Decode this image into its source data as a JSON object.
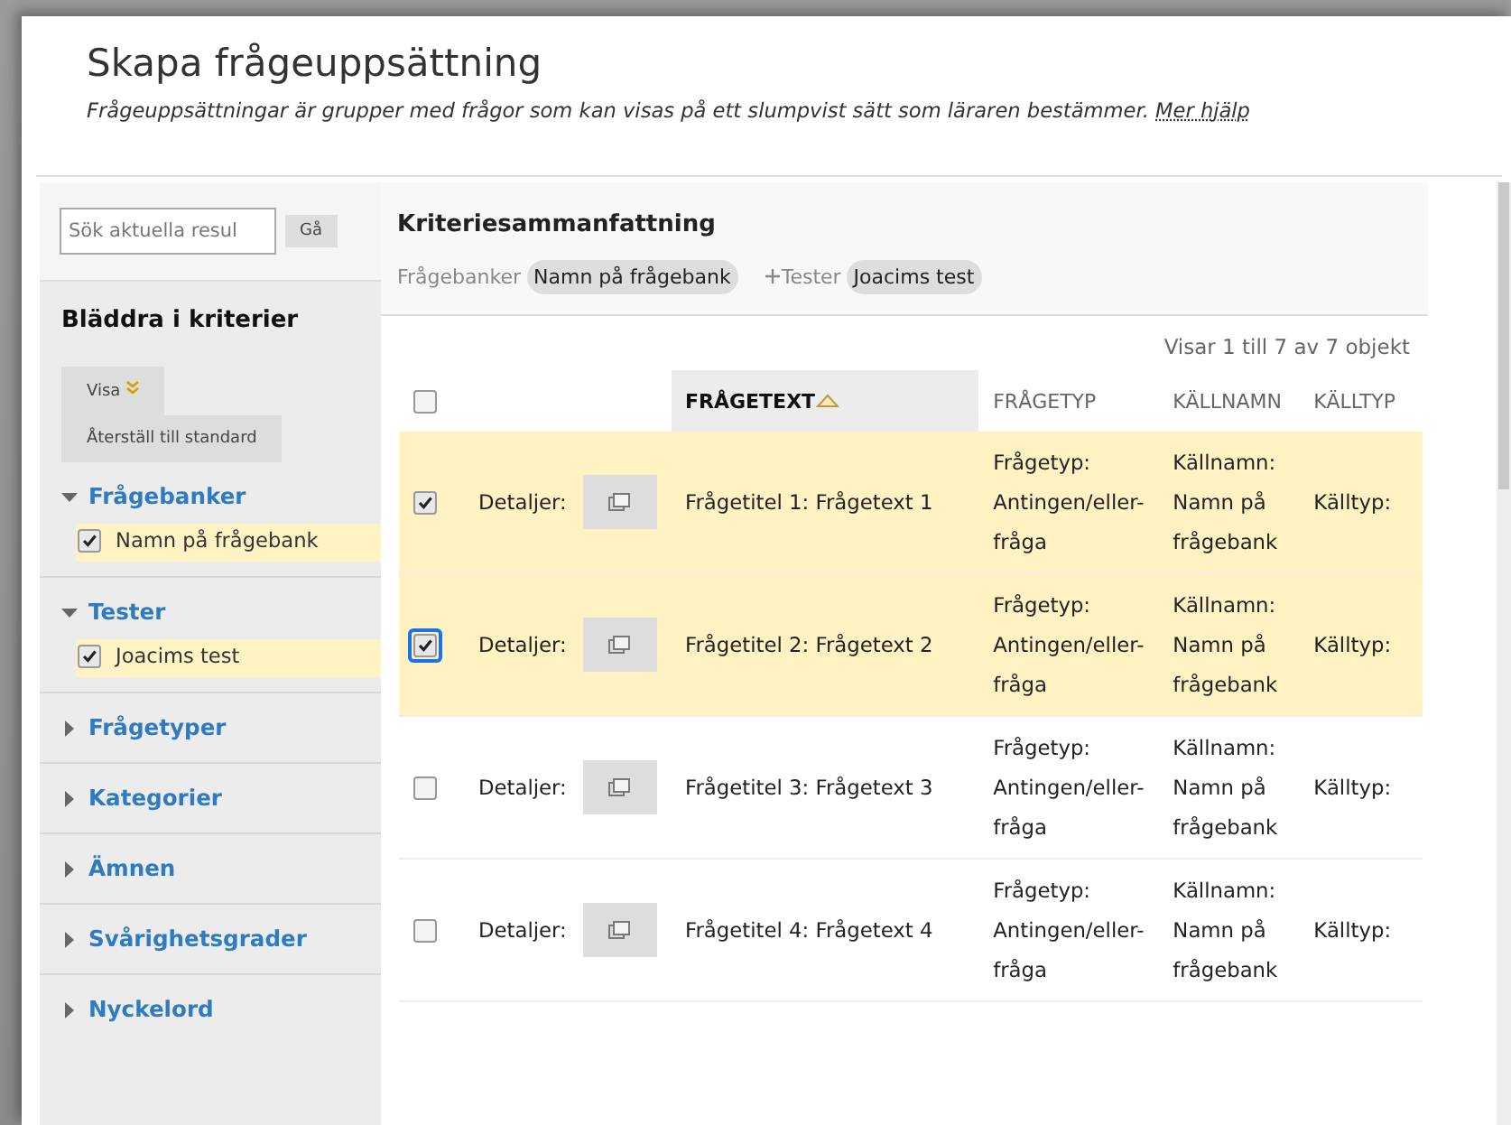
{
  "title": "Skapa frågeuppsättning",
  "description": {
    "text": "Frågeuppsättningar är grupper med frågor som kan visas på ett slumpvist sätt som läraren bestämmer.",
    "link": "Mer hjälp"
  },
  "search": {
    "placeholder": "Sök aktuella resul",
    "button": "Gå"
  },
  "sidebar": {
    "heading": "Bläddra i kriterier",
    "visa_button": "Visa",
    "reset_button": "Återställ till standard",
    "groups": [
      {
        "label": "Frågebanker",
        "expanded": true,
        "items": [
          {
            "label": "Namn på frågebank",
            "checked": true
          }
        ]
      },
      {
        "label": "Tester",
        "expanded": true,
        "items": [
          {
            "label": "Joacims test",
            "checked": true
          }
        ]
      },
      {
        "label": "Frågetyper",
        "expanded": false
      },
      {
        "label": "Kategorier",
        "expanded": false
      },
      {
        "label": "Ämnen",
        "expanded": false
      },
      {
        "label": "Svårighetsgrader",
        "expanded": false
      },
      {
        "label": "Nyckelord",
        "expanded": false
      }
    ]
  },
  "summary": {
    "heading": "Kriteriesammanfattning",
    "filters": [
      {
        "label": "Frågebanker",
        "value": "Namn på frågebank",
        "plus": false
      },
      {
        "label": "Tester",
        "value": "Joacims test",
        "plus": true
      }
    ]
  },
  "table": {
    "count": "Visar 1 till 7 av 7 objekt",
    "select_all": {
      "checked": false
    },
    "columns": [
      {
        "label": "FRÅGETEXT",
        "sorted": true
      },
      {
        "label": "FRÅGETYP",
        "sorted": false
      },
      {
        "label": "KÄLLNAMN",
        "sorted": false
      },
      {
        "label": "KÄLLTYP",
        "sorted": false
      }
    ],
    "rows": [
      {
        "selected": true,
        "checked": true,
        "focused": false,
        "details": "Detaljer:",
        "question": "Frågetitel 1: Frågetext 1",
        "type": "Frågetyp: Antingen/eller-fråga",
        "source": "Källnamn: Namn på frågebank",
        "source_type": "Källtyp:"
      },
      {
        "selected": true,
        "checked": true,
        "focused": true,
        "details": "Detaljer:",
        "question": "Frågetitel 2: Frågetext 2",
        "type": "Frågetyp: Antingen/eller-fråga",
        "source": "Källnamn: Namn på frågebank",
        "source_type": "Källtyp:"
      },
      {
        "selected": false,
        "checked": false,
        "focused": false,
        "details": "Detaljer:",
        "question": "Frågetitel 3: Frågetext 3",
        "type": "Frågetyp: Antingen/eller-fråga",
        "source": "Källnamn: Namn på frågebank",
        "source_type": "Källtyp:"
      },
      {
        "selected": false,
        "checked": false,
        "focused": false,
        "details": "Detaljer:",
        "question": "Frågetitel 4: Frågetext 4",
        "type": "Frågetyp: Antingen/eller-fråga",
        "source": "Källnamn: Namn på frågebank",
        "source_type": "Källtyp:"
      }
    ]
  }
}
